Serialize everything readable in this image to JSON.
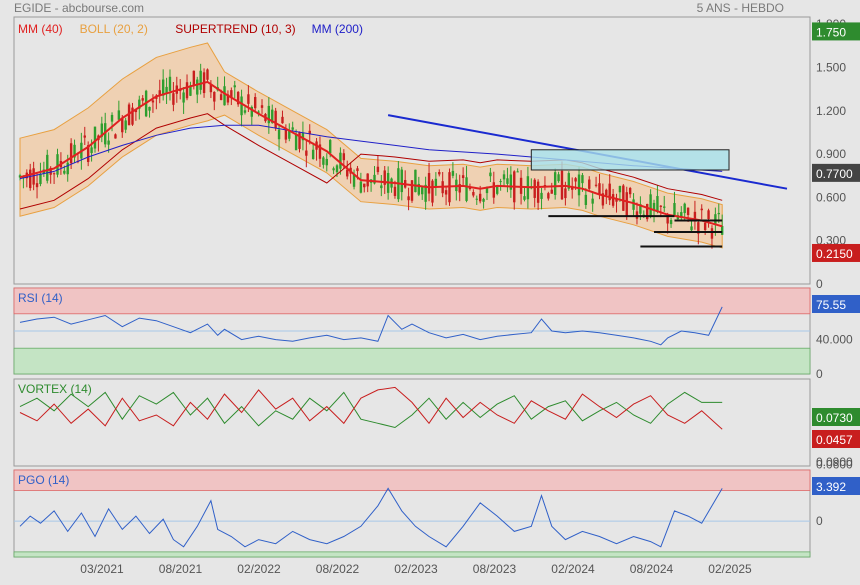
{
  "header": {
    "left": "EGIDE - abcbourse.com",
    "right": "5 ANS - HEBDO"
  },
  "x_axis": {
    "ticks": [
      "03/2021",
      "08/2021",
      "02/2022",
      "08/2022",
      "02/2023",
      "08/2023",
      "02/2024",
      "08/2024",
      "02/2025"
    ]
  },
  "chart_data": [
    {
      "type": "candlestick",
      "legend": [
        {
          "label": "MM (40)",
          "color": "#e02020"
        },
        {
          "label": "BOLL (20, 2)",
          "color": "#e8a040"
        },
        {
          "label": "SUPERTREND (10, 3)",
          "color": "#b00000"
        },
        {
          "label": "MM (200)",
          "color": "#2020c8"
        }
      ],
      "y_ticks": [
        "1.800",
        "1.500",
        "1.200",
        "0.900",
        "0.600",
        "0.300",
        "0"
      ],
      "ylim": [
        0,
        1.85
      ],
      "price_labels": [
        {
          "value": 1.75,
          "text": "1.750",
          "color": "#2e8b2e"
        },
        {
          "value": 0.77,
          "text": "0.7700",
          "color": "#444444"
        },
        {
          "value": 0.215,
          "text": "0.2150",
          "color": "#c81e1e"
        }
      ],
      "mm40": [
        [
          0,
          0.74
        ],
        [
          10,
          0.8
        ],
        [
          20,
          0.95
        ],
        [
          30,
          1.15
        ],
        [
          40,
          1.3
        ],
        [
          50,
          1.37
        ],
        [
          55,
          1.4
        ],
        [
          60,
          1.32
        ],
        [
          70,
          1.18
        ],
        [
          80,
          1.05
        ],
        [
          90,
          0.92
        ],
        [
          100,
          0.72
        ],
        [
          110,
          0.7
        ],
        [
          120,
          0.67
        ],
        [
          130,
          0.68
        ],
        [
          135,
          0.66
        ],
        [
          140,
          0.68
        ],
        [
          150,
          0.67
        ],
        [
          160,
          0.68
        ],
        [
          165,
          0.66
        ],
        [
          170,
          0.62
        ],
        [
          180,
          0.56
        ],
        [
          190,
          0.48
        ],
        [
          200,
          0.44
        ],
        [
          206,
          0.4
        ]
      ],
      "mm200": [
        [
          0,
          0.73
        ],
        [
          10,
          0.78
        ],
        [
          20,
          0.88
        ],
        [
          30,
          0.96
        ],
        [
          40,
          1.03
        ],
        [
          50,
          1.08
        ],
        [
          60,
          1.1
        ],
        [
          70,
          1.1
        ],
        [
          80,
          1.06
        ],
        [
          90,
          1.02
        ],
        [
          100,
          0.99
        ],
        [
          110,
          0.96
        ],
        [
          120,
          0.93
        ],
        [
          140,
          0.9
        ],
        [
          160,
          0.86
        ],
        [
          180,
          0.82
        ],
        [
          206,
          0.78
        ]
      ],
      "trendline": [
        [
          108,
          1.17
        ],
        [
          225,
          0.66
        ]
      ],
      "range_rect": {
        "x": [
          150,
          208
        ],
        "y": [
          0.79,
          0.93
        ]
      },
      "box_lines": [
        [
          155,
          0.47
        ],
        [
          192,
          0.47
        ],
        [
          192,
          0.44
        ],
        [
          206,
          0.44
        ],
        [
          186,
          0.36
        ],
        [
          206,
          0.36
        ],
        [
          182,
          0.26
        ],
        [
          206,
          0.26
        ]
      ]
    },
    {
      "type": "line",
      "title": "RSI (14)",
      "color": "#3060c8",
      "ylim": [
        0,
        100
      ],
      "zones": [
        [
          70,
          100
        ],
        [
          0,
          30
        ]
      ],
      "midline": 50,
      "y_ticks": [
        "40.000",
        "0"
      ],
      "last": "75.55",
      "last_color": "#3060c8",
      "values": [
        [
          0,
          60
        ],
        [
          5,
          64
        ],
        [
          10,
          66
        ],
        [
          15,
          58
        ],
        [
          20,
          63
        ],
        [
          25,
          68
        ],
        [
          30,
          55
        ],
        [
          35,
          65
        ],
        [
          40,
          62
        ],
        [
          45,
          55
        ],
        [
          50,
          48
        ],
        [
          55,
          58
        ],
        [
          58,
          45
        ],
        [
          60,
          52
        ],
        [
          65,
          40
        ],
        [
          70,
          44
        ],
        [
          75,
          40
        ],
        [
          80,
          38
        ],
        [
          85,
          42
        ],
        [
          90,
          45
        ],
        [
          95,
          40
        ],
        [
          100,
          42
        ],
        [
          105,
          38
        ],
        [
          108,
          68
        ],
        [
          112,
          52
        ],
        [
          115,
          58
        ],
        [
          120,
          48
        ],
        [
          125,
          42
        ],
        [
          130,
          46
        ],
        [
          135,
          40
        ],
        [
          140,
          44
        ],
        [
          145,
          46
        ],
        [
          150,
          48
        ],
        [
          153,
          64
        ],
        [
          156,
          50
        ],
        [
          160,
          48
        ],
        [
          165,
          50
        ],
        [
          170,
          48
        ],
        [
          175,
          45
        ],
        [
          180,
          42
        ],
        [
          185,
          38
        ],
        [
          188,
          34
        ],
        [
          190,
          42
        ],
        [
          194,
          50
        ],
        [
          198,
          48
        ],
        [
          202,
          45
        ],
        [
          206,
          78
        ]
      ]
    },
    {
      "type": "line",
      "title": "VORTEX (14)",
      "ylim": [
        0.04,
        1.08
      ],
      "y_ticks": [
        "0.0900",
        "0.0600"
      ],
      "last": [
        {
          "text": "0.0730",
          "color": "#2e8b2e"
        },
        {
          "text": "0.0457",
          "color": "#c81e1e"
        }
      ],
      "series": [
        {
          "color": "#2e8b2e",
          "values": [
            [
              0,
              0.75
            ],
            [
              5,
              0.85
            ],
            [
              10,
              0.7
            ],
            [
              15,
              0.9
            ],
            [
              20,
              0.75
            ],
            [
              25,
              0.92
            ],
            [
              30,
              0.6
            ],
            [
              35,
              0.88
            ],
            [
              40,
              0.78
            ],
            [
              45,
              0.92
            ],
            [
              50,
              0.65
            ],
            [
              55,
              0.85
            ],
            [
              60,
              0.55
            ],
            [
              65,
              0.75
            ],
            [
              70,
              0.52
            ],
            [
              75,
              0.7
            ],
            [
              80,
              0.6
            ],
            [
              85,
              0.85
            ],
            [
              90,
              0.7
            ],
            [
              95,
              0.92
            ],
            [
              100,
              0.6
            ],
            [
              105,
              0.55
            ],
            [
              110,
              0.5
            ],
            [
              115,
              0.65
            ],
            [
              120,
              0.85
            ],
            [
              125,
              0.6
            ],
            [
              130,
              0.8
            ],
            [
              135,
              0.62
            ],
            [
              140,
              0.78
            ],
            [
              145,
              0.88
            ],
            [
              150,
              0.6
            ],
            [
              155,
              0.75
            ],
            [
              160,
              0.82
            ],
            [
              165,
              0.58
            ],
            [
              170,
              0.7
            ],
            [
              175,
              0.8
            ],
            [
              180,
              0.65
            ],
            [
              185,
              0.55
            ],
            [
              190,
              0.78
            ],
            [
              195,
              0.92
            ],
            [
              200,
              0.8
            ],
            [
              206,
              0.8
            ]
          ]
        },
        {
          "color": "#c81e1e",
          "values": [
            [
              0,
              0.68
            ],
            [
              5,
              0.58
            ],
            [
              10,
              0.78
            ],
            [
              15,
              0.55
            ],
            [
              20,
              0.72
            ],
            [
              25,
              0.52
            ],
            [
              30,
              0.85
            ],
            [
              35,
              0.58
            ],
            [
              40,
              0.65
            ],
            [
              45,
              0.52
            ],
            [
              50,
              0.8
            ],
            [
              55,
              0.6
            ],
            [
              60,
              0.9
            ],
            [
              65,
              0.68
            ],
            [
              70,
              0.95
            ],
            [
              75,
              0.72
            ],
            [
              80,
              0.85
            ],
            [
              85,
              0.58
            ],
            [
              90,
              0.75
            ],
            [
              95,
              0.55
            ],
            [
              100,
              0.85
            ],
            [
              105,
              0.95
            ],
            [
              110,
              0.98
            ],
            [
              115,
              0.8
            ],
            [
              120,
              0.55
            ],
            [
              125,
              0.85
            ],
            [
              130,
              0.62
            ],
            [
              135,
              0.8
            ],
            [
              140,
              0.65
            ],
            [
              145,
              0.55
            ],
            [
              150,
              0.82
            ],
            [
              155,
              0.7
            ],
            [
              160,
              0.6
            ],
            [
              165,
              0.9
            ],
            [
              170,
              0.75
            ],
            [
              175,
              0.62
            ],
            [
              180,
              0.78
            ],
            [
              185,
              0.88
            ],
            [
              190,
              0.65
            ],
            [
              195,
              0.55
            ],
            [
              200,
              0.7
            ],
            [
              206,
              0.48
            ]
          ]
        }
      ]
    },
    {
      "type": "line",
      "title": "PGO (14)",
      "color": "#3060c8",
      "ylim": [
        -3.5,
        5
      ],
      "zones": [
        [
          3,
          5
        ],
        [
          -3.5,
          -3
        ]
      ],
      "midline": 0,
      "y_ticks": [
        "0"
      ],
      "last": "3.392",
      "last_color": "#3060c8",
      "values": [
        [
          0,
          -0.5
        ],
        [
          3,
          0.5
        ],
        [
          6,
          -0.2
        ],
        [
          10,
          1.0
        ],
        [
          14,
          -1.0
        ],
        [
          18,
          0.8
        ],
        [
          22,
          -1.5
        ],
        [
          26,
          1.2
        ],
        [
          30,
          -0.8
        ],
        [
          34,
          0.5
        ],
        [
          38,
          -1.2
        ],
        [
          42,
          0.2
        ],
        [
          45,
          -1.8
        ],
        [
          48,
          -2.5
        ],
        [
          52,
          -0.5
        ],
        [
          56,
          2.0
        ],
        [
          58,
          -0.8
        ],
        [
          62,
          -1.5
        ],
        [
          66,
          -2.5
        ],
        [
          70,
          -1.8
        ],
        [
          75,
          -2.2
        ],
        [
          80,
          -1.0
        ],
        [
          85,
          -1.8
        ],
        [
          90,
          -2.2
        ],
        [
          95,
          -1.5
        ],
        [
          100,
          -0.5
        ],
        [
          105,
          1.5
        ],
        [
          108,
          3.2
        ],
        [
          112,
          1.0
        ],
        [
          116,
          -0.5
        ],
        [
          120,
          -1.5
        ],
        [
          125,
          -2.5
        ],
        [
          130,
          -0.5
        ],
        [
          135,
          1.8
        ],
        [
          140,
          0.5
        ],
        [
          145,
          -1.0
        ],
        [
          150,
          -0.5
        ],
        [
          153,
          2.5
        ],
        [
          156,
          -0.5
        ],
        [
          160,
          -1.8
        ],
        [
          165,
          -1.0
        ],
        [
          170,
          -1.5
        ],
        [
          175,
          -2.2
        ],
        [
          180,
          -1.5
        ],
        [
          185,
          -2.0
        ],
        [
          188,
          -2.5
        ],
        [
          192,
          1.0
        ],
        [
          196,
          0.5
        ],
        [
          200,
          -0.2
        ],
        [
          206,
          3.2
        ]
      ]
    }
  ]
}
